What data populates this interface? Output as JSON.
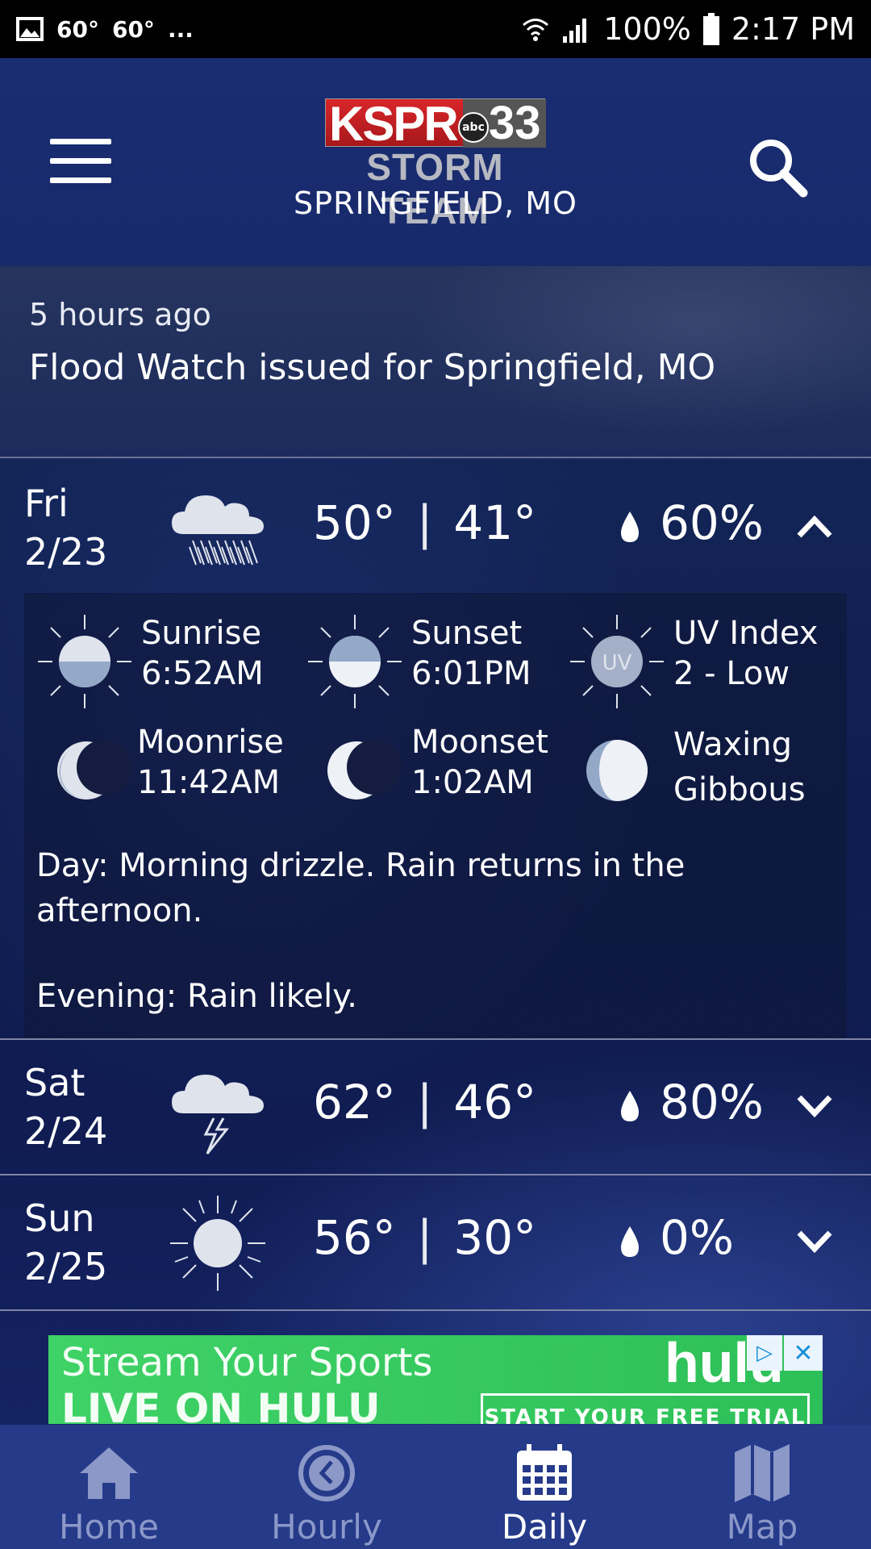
{
  "status_bar": {
    "temp1": "60°",
    "temp2": "60°",
    "more": "...",
    "battery": "100%",
    "time": "2:17 PM"
  },
  "header": {
    "logo_station": "KSPR",
    "logo_network": "abc",
    "logo_channel": "33",
    "logo_subtitle": "STORM TEAM",
    "location": "SPRINGFIELD, MO"
  },
  "alert": {
    "time_ago": "5 hours ago",
    "title": "Flood Watch issued for Springfield, MO"
  },
  "forecast": [
    {
      "day": "Fri",
      "date": "2/23",
      "icon": "rain-cloud-icon",
      "high": "50°",
      "low": "41°",
      "precip": "60%",
      "expanded": true
    },
    {
      "day": "Sat",
      "date": "2/24",
      "icon": "thunderstorm-cloud-icon",
      "high": "62°",
      "low": "46°",
      "precip": "80%",
      "expanded": false
    },
    {
      "day": "Sun",
      "date": "2/25",
      "icon": "sun-icon",
      "high": "56°",
      "low": "30°",
      "precip": "0%",
      "expanded": false
    }
  ],
  "temp_separator": "|",
  "details": {
    "sunrise_label": "Sunrise",
    "sunrise_value": "6:52AM",
    "sunset_label": "Sunset",
    "sunset_value": "6:01PM",
    "uv_label": "UV Index",
    "uv_value": "2 - Low",
    "uv_icon_text": "UV",
    "moonrise_label": "Moonrise",
    "moonrise_value": "11:42AM",
    "moonset_label": "Moonset",
    "moonset_value": "1:02AM",
    "moon_phase_line1": "Waxing",
    "moon_phase_line2": "Gibbous",
    "day_text": "Day: Morning drizzle.  Rain returns in the afternoon.",
    "evening_text": "Evening: Rain likely."
  },
  "ad": {
    "line1": "Stream Your Sports",
    "line2": "LIVE ON HULU",
    "brand": "hulu",
    "cta": "START YOUR FREE TRIAL"
  },
  "nav": {
    "home": "Home",
    "hourly": "Hourly",
    "daily": "Daily",
    "map": "Map"
  },
  "colors": {
    "header_bg": "#1a2d73",
    "nav_bg": "#263a8a",
    "nav_inactive": "#8b98c8",
    "ad_green": "#3fd267"
  }
}
